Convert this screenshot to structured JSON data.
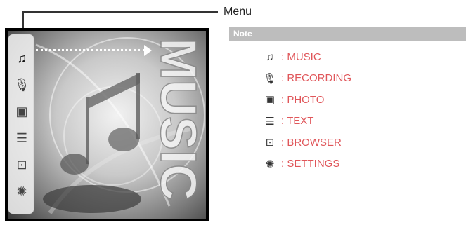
{
  "menu_label": "Menu",
  "note_title": "Note",
  "art_text": "MUSIC",
  "colors": {
    "note_bar": "#bdbdbd",
    "item_text": "#e0565a",
    "strip_border": "#dcdcdc"
  },
  "strip_icons": [
    {
      "name": "music-icon",
      "glyph": "♫",
      "selected": true
    },
    {
      "name": "recording-icon",
      "glyph": "🎙"
    },
    {
      "name": "photo-icon",
      "glyph": "▣"
    },
    {
      "name": "text-icon",
      "glyph": "☰"
    },
    {
      "name": "browser-icon",
      "glyph": "⊡"
    },
    {
      "name": "settings-icon",
      "glyph": "✺"
    }
  ],
  "items": [
    {
      "icon": "music-icon",
      "glyph": "♫",
      "label": ": MUSIC"
    },
    {
      "icon": "recording-icon",
      "glyph": "🎙",
      "label": ": RECORDING"
    },
    {
      "icon": "photo-icon",
      "glyph": "▣",
      "label": ": PHOTO"
    },
    {
      "icon": "text-icon",
      "glyph": "☰",
      "label": ": TEXT"
    },
    {
      "icon": "browser-icon",
      "glyph": "⊡",
      "label": ": BROWSER"
    },
    {
      "icon": "settings-icon",
      "glyph": "✺",
      "label": ": SETTINGS"
    }
  ]
}
